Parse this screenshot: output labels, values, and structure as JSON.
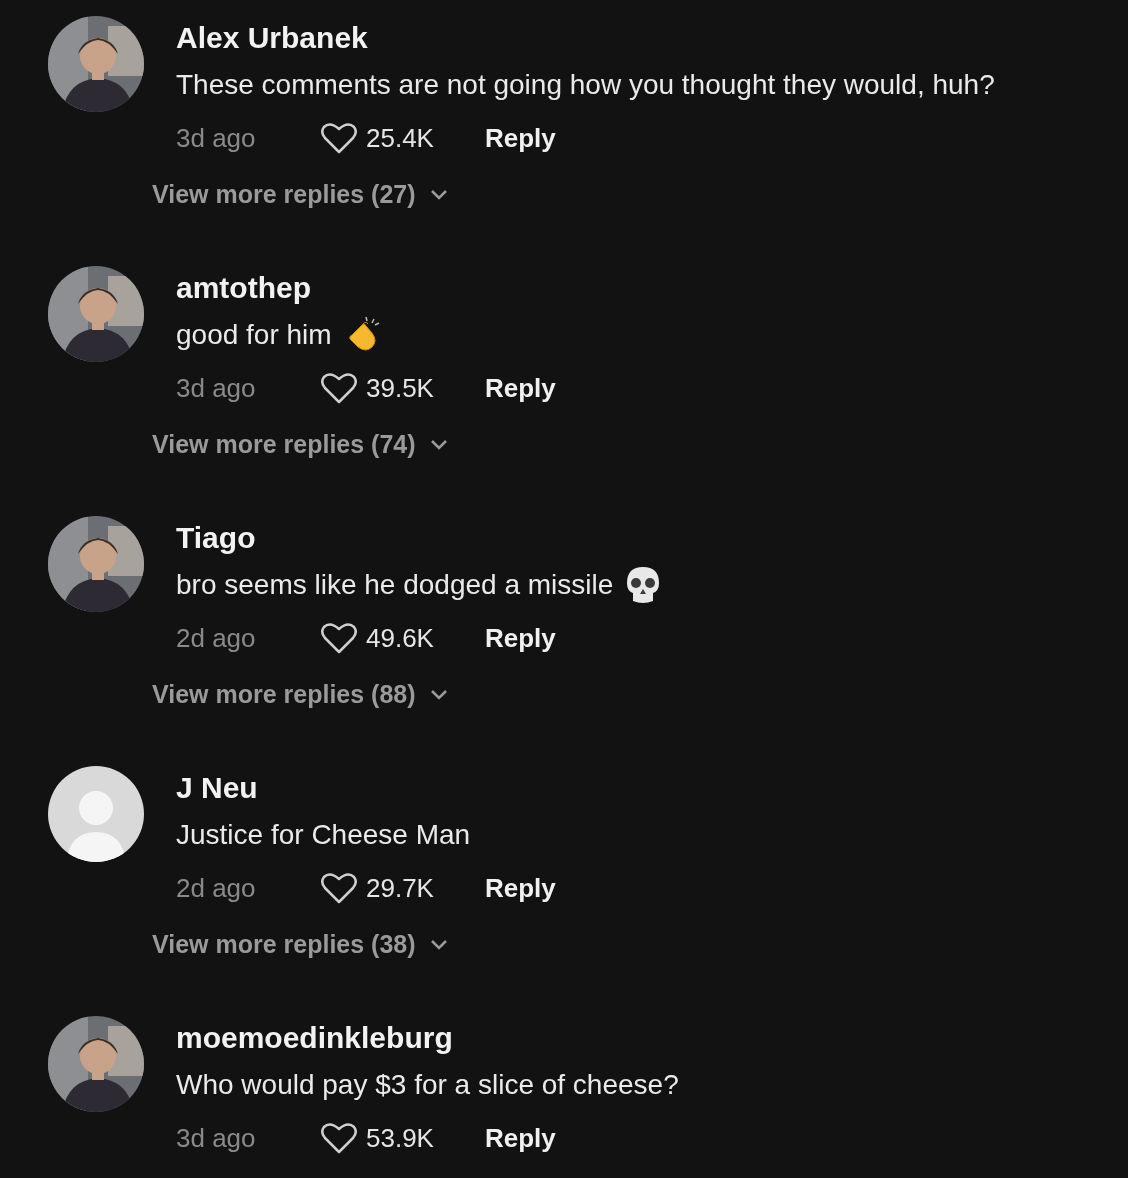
{
  "comments": [
    {
      "name": "Alex Urbanek",
      "text": "These comments are not going how you thought they would, huh?",
      "time": "3d ago",
      "likes": "25.4K",
      "reply": "Reply",
      "more_replies": "View more replies (27)"
    },
    {
      "name": "amtothep",
      "text": "good for him",
      "emoji": {
        "kind": "clap"
      },
      "time": "3d ago",
      "likes": "39.5K",
      "reply": "Reply",
      "more_replies": "View more replies (74)"
    },
    {
      "name": "Tiago",
      "text": "bro seems like he dodged a missile",
      "emoji": {
        "kind": "skull"
      },
      "time": "2d ago",
      "likes": "49.6K",
      "reply": "Reply",
      "more_replies": "View more replies (88)"
    },
    {
      "avatar": {
        "kind": "default"
      },
      "name": "J Neu",
      "text": "Justice for Cheese Man",
      "time": "2d ago",
      "likes": "29.7K",
      "reply": "Reply",
      "more_replies": "View more replies (38)"
    },
    {
      "name": "moemoedinkleburg",
      "text": "Who would pay $3 for a slice of cheese?",
      "time": "3d ago",
      "likes": "53.9K",
      "reply": "Reply"
    }
  ]
}
